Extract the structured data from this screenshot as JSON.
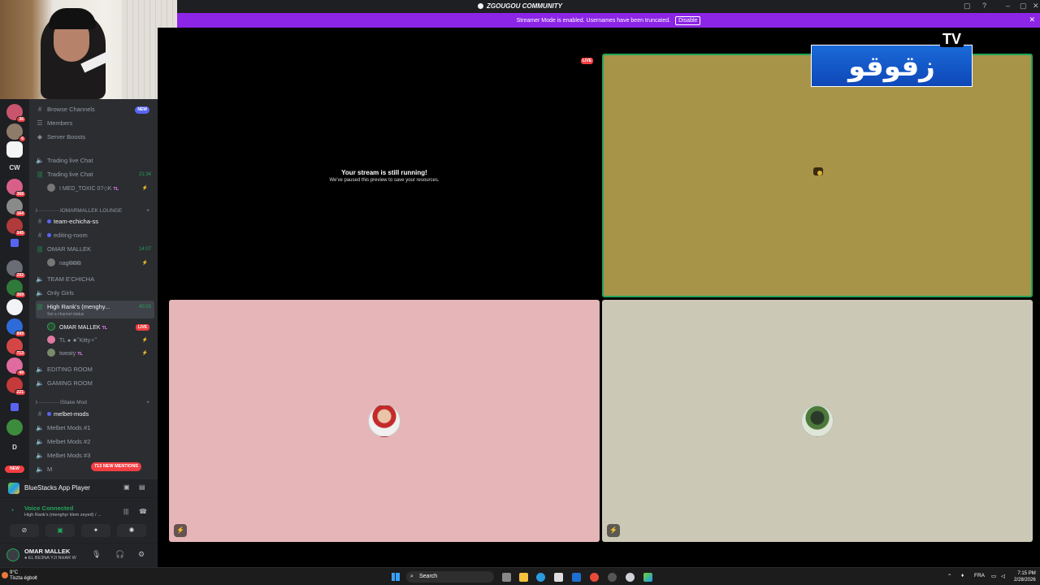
{
  "window": {
    "title": "ZGOUGOU COMMUNITY",
    "controls": [
      "▢",
      "?",
      "–",
      "▢",
      "✕"
    ]
  },
  "banner": {
    "text": "Streamer Mode is enabled. Usernames have been truncated.",
    "button": "Disable",
    "close": "✕"
  },
  "rail": {
    "badges": [
      "36",
      "6",
      "",
      "368",
      "164",
      "345",
      "292",
      "369",
      "899",
      "713",
      "49",
      "221"
    ],
    "cw": "CW",
    "d": "D",
    "new": "NEW",
    "colors": [
      "#c9556d",
      "#8e7b6a",
      "#f5f5f5",
      "#d86088",
      "#8a8a8a",
      "#b13a3a",
      "#6a6d75",
      "#2e6bd8",
      "#d44646",
      "#9bd1ff",
      "#e06b9e",
      "#c53a3a",
      "#3d8b3d"
    ]
  },
  "sidebar": {
    "top_items": [
      {
        "label": "Browse Channels",
        "icon": "browse-icon",
        "pill": "NEW"
      },
      {
        "label": "Members",
        "icon": "members-icon"
      },
      {
        "label": "Server Boosts",
        "icon": "boost-icon"
      }
    ],
    "trading": {
      "chat1": "Trading live Chat",
      "chat2": "Trading live Chat",
      "time": "21:34",
      "user": "I MED_TOXIC 07◇K",
      "user_tag": "TL"
    },
    "lounge_category": "I·············IOMARMALLEK LOUNGE",
    "lounge_channels": {
      "team": "team-echicha-ss",
      "editing": "editing-room",
      "omar": "OMAR MALLEK",
      "omar_time": "14:07",
      "omar_user": "nag⧉⧉⧉",
      "team_echicha": "TEAM E'CHICHA",
      "only_girls": "Only Girls",
      "high_rank": "High Rank's (menghy...",
      "high_rank_time": "40:03",
      "high_rank_status": "Set a channel status"
    },
    "voice_users": [
      {
        "name": "OMAR MALLEK",
        "tag": "TL",
        "live": "LIVE"
      },
      {
        "name": "TL ● ★˚Kitty✧˚",
        "tag": ""
      },
      {
        "name": "tweaty",
        "tag": "TL"
      }
    ],
    "more_channels": [
      "EDITING ROOM",
      "GAMING ROOM"
    ],
    "stake_category": "I·············IStake Mod",
    "melbet": [
      "melbet-mods",
      "Melbet Mods #1",
      "Melbet Mods #2",
      "Melbet Mods #3",
      "M"
    ],
    "mentions": "713 NEW MENTIONS"
  },
  "activity": {
    "app": "BlueStacks App Player"
  },
  "voice": {
    "status": "Voice Connected",
    "channel": "High Rank's (menghyr klem zeyed) / ..."
  },
  "user": {
    "name": "OMAR MALLEK",
    "status": "● EL BE3NA YJI NHAR W"
  },
  "stage": {
    "self_title": "Your stream is still running!",
    "self_sub": "We've paused this preview to save your resources.",
    "live": "LIVE",
    "logo_text": "زقوقو",
    "logo_tv": "TV"
  },
  "taskbar": {
    "weather_temp": "9°C",
    "weather_desc": "Tiszta égbolt",
    "search": "Search",
    "lang": "FRA",
    "time": "7:15 PM",
    "date": "2/28/2026"
  }
}
